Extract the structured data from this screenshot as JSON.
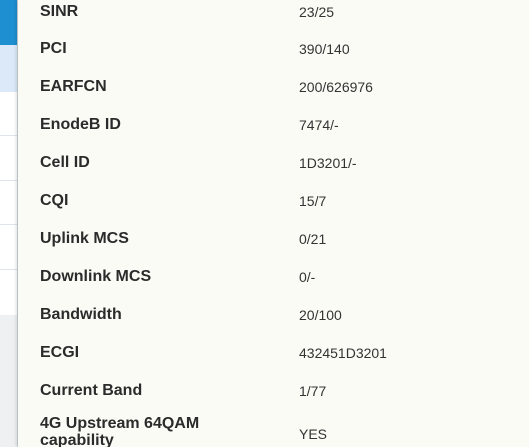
{
  "rows": [
    {
      "label": "SINR",
      "value": "23/25"
    },
    {
      "label": "PCI",
      "value": "390/140"
    },
    {
      "label": "EARFCN",
      "value": "200/626976"
    },
    {
      "label": "EnodeB ID",
      "value": "7474/-"
    },
    {
      "label": "Cell ID",
      "value": "1D3201/-"
    },
    {
      "label": "CQI",
      "value": "15/7"
    },
    {
      "label": "Uplink MCS",
      "value": "0/21"
    },
    {
      "label": "Downlink MCS",
      "value": "0/-"
    },
    {
      "label": "Bandwidth",
      "value": "20/100"
    },
    {
      "label": "ECGI",
      "value": "432451D3201"
    },
    {
      "label": "Current Band",
      "value": "1/77"
    },
    {
      "label": "4G Upstream 64QAM capability",
      "value": "YES"
    }
  ],
  "colors": {
    "panel_bg": "#fbfbf6",
    "left_accent": "#1e8fd0",
    "left_highlight": "#dbe9f8",
    "left_grey": "#eef0f2"
  }
}
